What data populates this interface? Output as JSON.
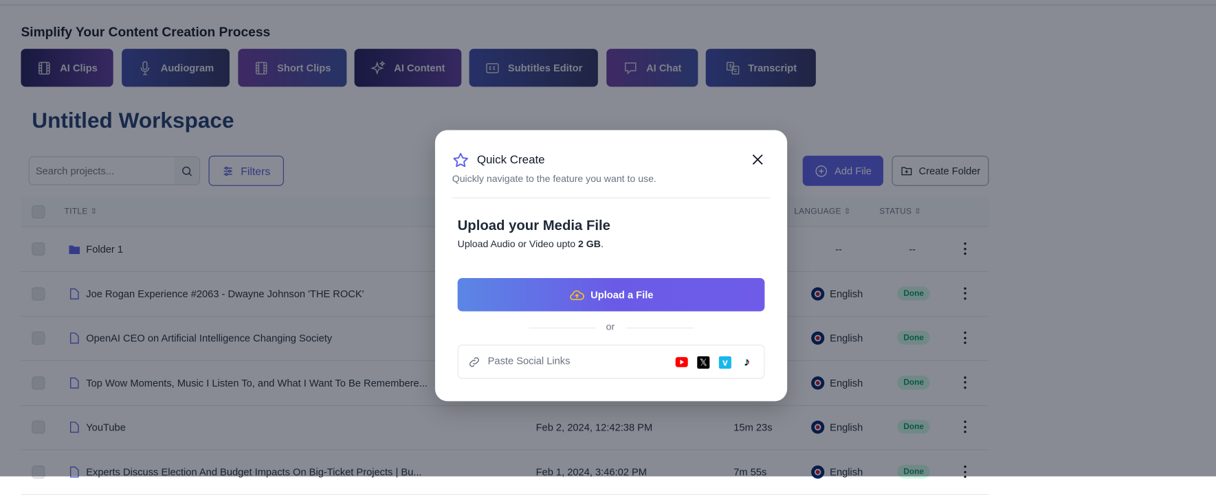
{
  "header": {
    "title": "Simplify Your Content Creation Process"
  },
  "features": [
    {
      "label": "AI Clips",
      "icon": "film-icon"
    },
    {
      "label": "Audiogram",
      "icon": "microphone-icon"
    },
    {
      "label": "Short Clips",
      "icon": "film-icon"
    },
    {
      "label": "AI Content",
      "icon": "sparkles-icon"
    },
    {
      "label": "Subtitles Editor",
      "icon": "closed-captions-icon"
    },
    {
      "label": "AI Chat",
      "icon": "chat-bubble-icon"
    },
    {
      "label": "Transcript",
      "icon": "translate-icon"
    }
  ],
  "workspace": {
    "title": "Untitled Workspace"
  },
  "toolbar": {
    "search_placeholder": "Search projects...",
    "filters": "Filters",
    "add_file": "Add File",
    "create_folder": "Create Folder"
  },
  "table": {
    "headers": {
      "title": "TITLE",
      "language": "LANGUAGE",
      "status": "STATUS"
    },
    "rows": [
      {
        "type": "folder",
        "title": "Folder 1",
        "date": "",
        "duration": "",
        "language": "--",
        "status": "--"
      },
      {
        "type": "file",
        "title": "Joe Rogan Experience #2063 - Dwayne Johnson 'THE ROCK'",
        "date": "",
        "duration": "",
        "language": "English",
        "status": "Done"
      },
      {
        "type": "file",
        "title": "OpenAI CEO on Artificial Intelligence Changing Society",
        "date": "",
        "duration": "",
        "language": "English",
        "status": "Done"
      },
      {
        "type": "file",
        "title": "Top Wow Moments, Music I Listen To, and What I Want To Be Remembere...",
        "date": "",
        "duration": "",
        "language": "English",
        "status": "Done"
      },
      {
        "type": "file",
        "title": "YouTube",
        "date": "Feb 2, 2024, 12:42:38 PM",
        "duration": "15m 23s",
        "language": "English",
        "status": "Done"
      },
      {
        "type": "file",
        "title": "Experts Discuss Election And Budget Impacts On Big-Ticket Projects | Bu...",
        "date": "Feb 1, 2024, 3:46:02 PM",
        "duration": "7m 55s",
        "language": "English",
        "status": "Done"
      }
    ]
  },
  "modal": {
    "title": "Quick Create",
    "subtitle": "Quickly navigate to the feature you want to use.",
    "heading": "Upload your Media File",
    "desc_prefix": "Upload Audio or Video upto ",
    "desc_bold": "2 GB",
    "desc_suffix": ".",
    "upload_label": "Upload a File",
    "or": "or",
    "social_placeholder": "Paste Social Links",
    "social_icons": [
      "youtube-icon",
      "x-icon",
      "vimeo-icon",
      "tiktok-icon"
    ]
  },
  "colors": {
    "accent": "#5a5ee8",
    "status_done": "#059669",
    "youtube": "#ff0000",
    "vimeo": "#1ab7ea"
  }
}
